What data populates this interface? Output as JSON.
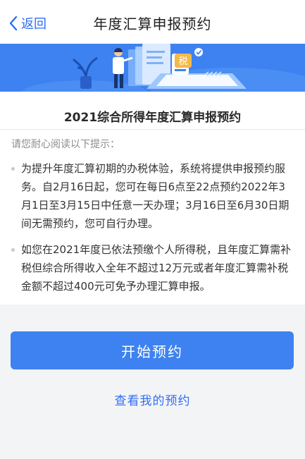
{
  "nav": {
    "back_label": "返回",
    "title": "年度汇算申报预约"
  },
  "banner": {
    "badge_text": "税"
  },
  "card": {
    "title": "2021综合所得年度汇算申报预约",
    "hint": "请您耐心阅读以下提示：",
    "tips": [
      {
        "text": "为提升年度汇算初期的办税体验，系统将提供申报预约服务。自2月16日起，您可在每日6点至22点预约2022年3月1日至3月15日中任意一天办理；3月16日至6月30日期间无需预约，您可自行办理。"
      },
      {
        "text": "如您在2021年度已依法预缴个人所得税，且年度汇算需补税但综合所得收入全年不超过12万元或者年度汇算需补税金额不超过400元可免予办理汇算申报。"
      }
    ]
  },
  "actions": {
    "start_label": "开始预约",
    "view_label": "查看我的预约"
  },
  "colors": {
    "accent": "#3d82f0",
    "link": "#2f6df6"
  }
}
